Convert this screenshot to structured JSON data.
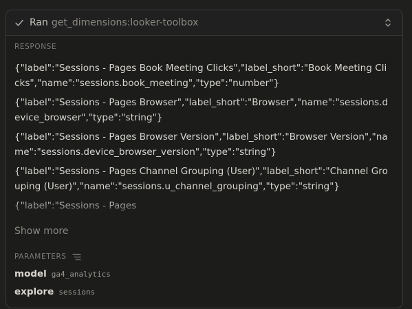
{
  "header": {
    "status": "Ran",
    "tool_name": "get_dimensions:looker-toolbox"
  },
  "response": {
    "label": "RESPONSE",
    "items": [
      "{\"label\":\"Sessions - Pages Book Meeting Clicks\",\"label_short\":\"Book Meeting Clicks\",\"name\":\"sessions.book_meeting\",\"type\":\"number\"}",
      "{\"label\":\"Sessions - Pages Browser\",\"label_short\":\"Browser\",\"name\":\"sessions.device_browser\",\"type\":\"string\"}",
      "{\"label\":\"Sessions - Pages Browser Version\",\"label_short\":\"Browser Version\",\"name\":\"sessions.device_browser_version\",\"type\":\"string\"}",
      "{\"label\":\"Sessions - Pages Channel Grouping (User)\",\"label_short\":\"Channel Grouping (User)\",\"name\":\"sessions.u_channel_grouping\",\"type\":\"string\"}",
      "{\"label\":\"Sessions - Pages"
    ],
    "show_more": "Show more"
  },
  "parameters": {
    "label": "PARAMETERS",
    "items": [
      {
        "name": "model",
        "value": "ga4_analytics"
      },
      {
        "name": "explore",
        "value": "sessions"
      }
    ]
  }
}
